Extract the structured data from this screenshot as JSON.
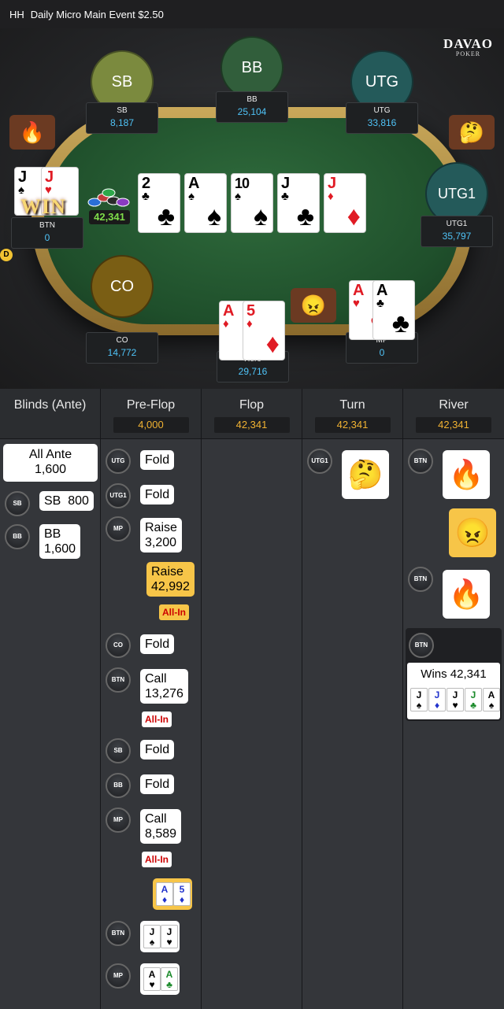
{
  "header": {
    "tag": "HH",
    "title": "Daily Micro Main Event $2.50"
  },
  "logo": {
    "line1": "DAVAO",
    "line2": "POKER"
  },
  "seats": [
    {
      "key": "sb",
      "circle": "SB",
      "name": "SB",
      "stack": "8,187",
      "color": "#7b8a3e"
    },
    {
      "key": "bb",
      "circle": "BB",
      "name": "BB",
      "stack": "25,104",
      "color": "#315e3b"
    },
    {
      "key": "utg",
      "circle": "UTG",
      "name": "UTG",
      "stack": "33,816",
      "color": "#245a5a"
    },
    {
      "key": "utg1",
      "circle": "UTG1",
      "name": "UTG1",
      "stack": "35,797",
      "color": "#245a5a"
    },
    {
      "key": "co",
      "circle": "CO",
      "name": "CO",
      "stack": "14,772",
      "color": "#7a5e14"
    },
    {
      "key": "hero",
      "name": "Hero",
      "stack": "29,716"
    },
    {
      "key": "mp",
      "name": "MP",
      "stack": "0"
    },
    {
      "key": "btn",
      "name": "BTN",
      "stack": "0"
    }
  ],
  "table": {
    "win_text": "WIN",
    "pot_chips": "42,341",
    "dealer": "D"
  },
  "board": [
    {
      "rank": "2",
      "suit": "♣",
      "red": false
    },
    {
      "rank": "A",
      "suit": "♠",
      "red": false
    },
    {
      "rank": "10",
      "suit": "♠",
      "red": false
    },
    {
      "rank": "J",
      "suit": "♣",
      "red": false
    },
    {
      "rank": "J",
      "suit": "♦",
      "red": true
    }
  ],
  "hands": {
    "btn": [
      {
        "rank": "J",
        "suit": "♠",
        "red": false
      },
      {
        "rank": "J",
        "suit": "♥",
        "red": true
      }
    ],
    "hero": [
      {
        "rank": "A",
        "suit": "♦",
        "red": true
      },
      {
        "rank": "5",
        "suit": "♦",
        "red": true
      }
    ],
    "mp": [
      {
        "rank": "A",
        "suit": "♥",
        "red": true
      },
      {
        "rank": "A",
        "suit": "♣",
        "red": false
      }
    ]
  },
  "emotes": {
    "fire": "🔥",
    "face": "😠",
    "think": "🤔"
  },
  "history": {
    "columns": [
      {
        "title": "Blinds (Ante)",
        "pot": ""
      },
      {
        "title": "Pre-Flop",
        "pot": "4,000"
      },
      {
        "title": "Flop",
        "pot": "42,341"
      },
      {
        "title": "Turn",
        "pot": "42,341"
      },
      {
        "title": "River",
        "pot": "42,341"
      }
    ],
    "blinds": {
      "ante_label": "All Ante",
      "ante_value": "1,600",
      "sb_label": "SB",
      "sb_value": "800",
      "bb_label": "BB",
      "bb_value": "1,600"
    },
    "preflop": [
      {
        "pos": "UTG",
        "action": "Fold"
      },
      {
        "pos": "UTG1",
        "action": "Fold"
      },
      {
        "pos": "MP",
        "action": "Raise",
        "amount": "3,200"
      },
      {
        "pos": "Hero",
        "action": "Raise",
        "amount": "42,992",
        "allin": "All-In"
      },
      {
        "pos": "CO",
        "action": "Fold"
      },
      {
        "pos": "BTN",
        "action": "Call",
        "amount": "13,276",
        "allin": "All-In"
      },
      {
        "pos": "SB",
        "action": "Fold"
      },
      {
        "pos": "BB",
        "action": "Fold"
      },
      {
        "pos": "MP",
        "action": "Call",
        "amount": "8,589",
        "allin": "All-In"
      }
    ],
    "showdown": {
      "btn_pos": "BTN",
      "mp_pos": "MP"
    },
    "turn": {
      "pos": "UTG1"
    },
    "river": {
      "pos1": "BTN",
      "pos2": "BTN",
      "pos3": "BTN",
      "wins": "Wins 42,341"
    }
  },
  "winning_hand": [
    {
      "rank": "J",
      "suit": "♠",
      "red": false
    },
    {
      "rank": "J",
      "suit": "♦",
      "red": false,
      "color": "#2233cc"
    },
    {
      "rank": "J",
      "suit": "♥",
      "red": true
    },
    {
      "rank": "J",
      "suit": "♣",
      "red": false,
      "color": "#1a8a2a"
    },
    {
      "rank": "A",
      "suit": "♠",
      "red": false
    }
  ]
}
